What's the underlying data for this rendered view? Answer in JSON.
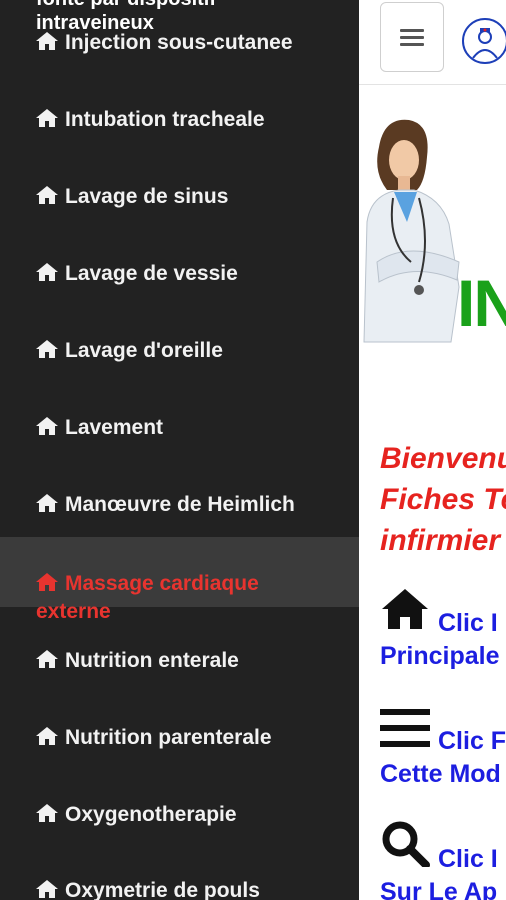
{
  "drawer": {
    "cut_off_item": {
      "line1": "fonte par dispositif",
      "line2": "intraveineux"
    },
    "items": [
      {
        "label": "Injection sous-cutanee"
      },
      {
        "label": "Intubation tracheale"
      },
      {
        "label": "Lavage de sinus"
      },
      {
        "label": "Lavage de vessie"
      },
      {
        "label": "Lavage d'oreille"
      },
      {
        "label": "Lavement"
      },
      {
        "label": "Manœuvre de Heimlich"
      },
      {
        "label_line1": "Massage cardiaque",
        "label_line2": "externe",
        "selected": true
      },
      {
        "label": "Nutrition enterale"
      },
      {
        "label": "Nutrition parenterale"
      },
      {
        "label": "Oxygenotherapie"
      },
      {
        "label": "Oxymetrie de pouls"
      }
    ],
    "colors": {
      "background": "#222222",
      "selected_background": "#3b3b3b",
      "selected_text": "#e8342f",
      "text": "#f2f2f2"
    }
  },
  "main": {
    "hero_text_fragment": "IN",
    "welcome_lines": [
      "Bienvenu",
      "Fiches Te",
      "infirmier"
    ],
    "info_rows": [
      {
        "icon": "home-icon",
        "line1": "Clic I",
        "line2": "Principale"
      },
      {
        "icon": "menu-icon",
        "line1": "Clic F",
        "line2": "Cette Mod"
      },
      {
        "icon": "search-icon",
        "line1": "Clic I",
        "line2": "Sur Le Ap"
      }
    ],
    "colors": {
      "welcome": "#e6231f",
      "info": "#1c1ee0",
      "hero_text": "#1aa11a"
    }
  }
}
